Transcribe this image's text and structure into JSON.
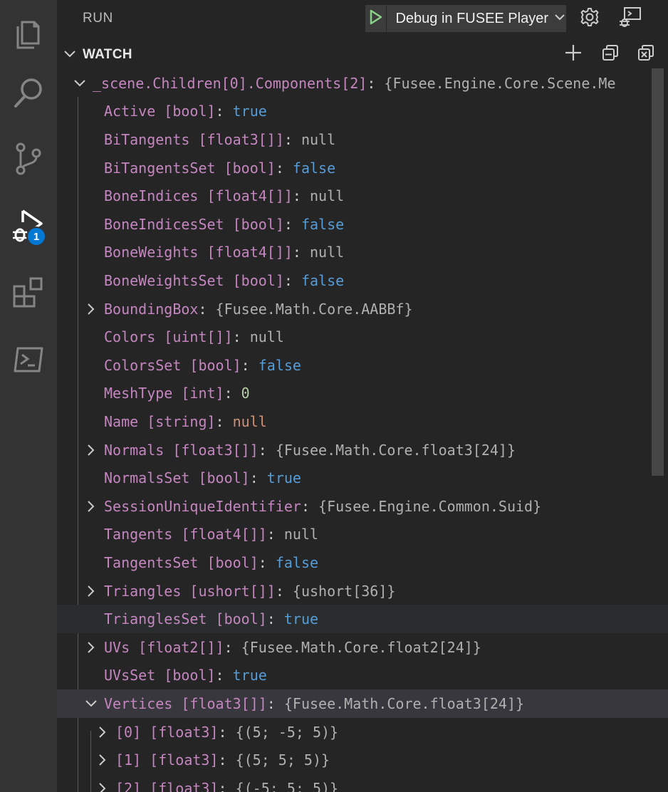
{
  "activity_bar": {
    "items": [
      {
        "name": "explorer",
        "icon": "files-icon"
      },
      {
        "name": "search",
        "icon": "search-icon"
      },
      {
        "name": "source-control",
        "icon": "source-control-icon"
      },
      {
        "name": "run-and-debug",
        "icon": "debug-icon",
        "badge": "1"
      },
      {
        "name": "extensions",
        "icon": "extensions-icon"
      },
      {
        "name": "terminal",
        "icon": "terminal-icon"
      }
    ]
  },
  "run_header": {
    "title": "RUN",
    "config_label": "Debug in FUSEE Player",
    "play_icon": "play-icon",
    "settings_icon": "gear-icon",
    "debug_console_icon": "debug-console-icon"
  },
  "watch": {
    "title": "WATCH",
    "add_icon": "add-icon",
    "collapse_icon": "collapse-all-icon",
    "remove_all_icon": "remove-all-icon",
    "root": {
      "name": "_scene.Children[0].Components[2]",
      "value": "{Fusee.Engine.Core.Scene.Me"
    },
    "rows": [
      {
        "name": "Active [bool]",
        "value": "true",
        "kind": "bool",
        "expandable": false
      },
      {
        "name": "BiTangents [float3[]]",
        "value": "null",
        "kind": "null",
        "expandable": false
      },
      {
        "name": "BiTangentsSet [bool]",
        "value": "false",
        "kind": "bool",
        "expandable": false
      },
      {
        "name": "BoneIndices [float4[]]",
        "value": "null",
        "kind": "null",
        "expandable": false
      },
      {
        "name": "BoneIndicesSet [bool]",
        "value": "false",
        "kind": "bool",
        "expandable": false
      },
      {
        "name": "BoneWeights [float4[]]",
        "value": "null",
        "kind": "null",
        "expandable": false
      },
      {
        "name": "BoneWeightsSet [bool]",
        "value": "false",
        "kind": "bool",
        "expandable": false
      },
      {
        "name": "BoundingBox",
        "value": "{Fusee.Math.Core.AABBf}",
        "kind": "obj",
        "expandable": true
      },
      {
        "name": "Colors [uint[]]",
        "value": "null",
        "kind": "null",
        "expandable": false
      },
      {
        "name": "ColorsSet [bool]",
        "value": "false",
        "kind": "bool",
        "expandable": false
      },
      {
        "name": "MeshType [int]",
        "value": "0",
        "kind": "num",
        "expandable": false
      },
      {
        "name": "Name [string]",
        "value": "null",
        "kind": "nullw",
        "expandable": false
      },
      {
        "name": "Normals [float3[]]",
        "value": "{Fusee.Math.Core.float3[24]}",
        "kind": "obj",
        "expandable": true
      },
      {
        "name": "NormalsSet [bool]",
        "value": "true",
        "kind": "bool",
        "expandable": false
      },
      {
        "name": "SessionUniqueIdentifier",
        "value": "{Fusee.Engine.Common.Suid}",
        "kind": "obj",
        "expandable": true
      },
      {
        "name": "Tangents [float4[]]",
        "value": "null",
        "kind": "null",
        "expandable": false
      },
      {
        "name": "TangentsSet [bool]",
        "value": "false",
        "kind": "bool",
        "expandable": false
      },
      {
        "name": "Triangles [ushort[]]",
        "value": "{ushort[36]}",
        "kind": "obj",
        "expandable": true
      },
      {
        "name": "TrianglesSet [bool]",
        "value": "true",
        "kind": "bool",
        "expandable": false,
        "state": "hover"
      },
      {
        "name": "UVs [float2[]]",
        "value": "{Fusee.Math.Core.float2[24]}",
        "kind": "obj",
        "expandable": true
      },
      {
        "name": "UVsSet [bool]",
        "value": "true",
        "kind": "bool",
        "expandable": false
      },
      {
        "name": "Vertices [float3[]]",
        "value": "{Fusee.Math.Core.float3[24]}",
        "kind": "obj",
        "expandable": true,
        "expanded": true,
        "state": "selected"
      }
    ],
    "vertex_rows": [
      {
        "name": "[0] [float3]",
        "value": "{(5; -5; 5)}"
      },
      {
        "name": "[1] [float3]",
        "value": "{(5; 5; 5)}"
      },
      {
        "name": "[2] [float3]",
        "value": "{(-5; 5; 5)}"
      }
    ]
  }
}
